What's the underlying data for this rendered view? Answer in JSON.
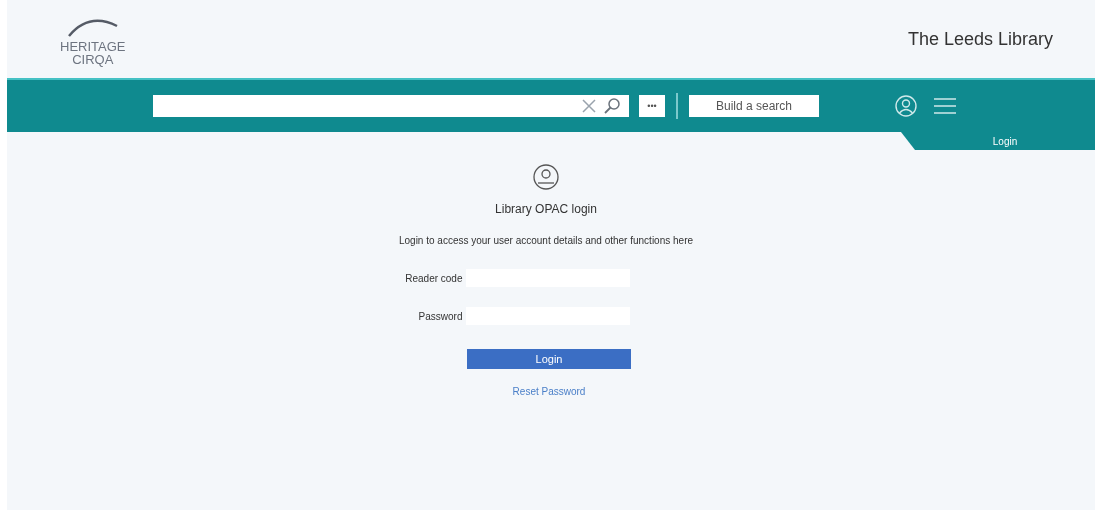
{
  "header": {
    "logo_lines": [
      "HERITAGE",
      "CIRQA"
    ],
    "site_title": "The Leeds Library"
  },
  "toolbar": {
    "build_search": "Build a search",
    "more": "•••",
    "login_tab": "Login"
  },
  "login": {
    "title": "Library OPAC login",
    "description": "Login to access your user account details and other functions here",
    "fields": [
      {
        "label": "Reader code"
      },
      {
        "label": "Password"
      }
    ],
    "button": "Login",
    "reset_link": "Reset Password"
  }
}
